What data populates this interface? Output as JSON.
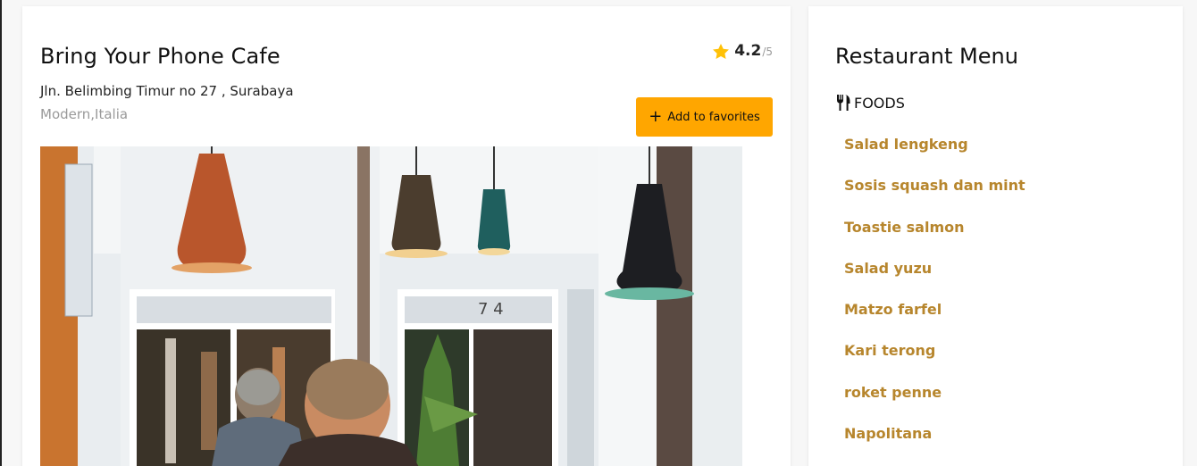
{
  "restaurant": {
    "name": "Bring Your Phone Cafe",
    "address": "Jln. Belimbing Timur no 27 , Surabaya",
    "tags": "Modern,Italia",
    "rating_value": "4.2",
    "rating_max": "/5",
    "favorite_label": "Add to favorites",
    "favorite_icon": "plus-icon",
    "rating_icon": "star-icon",
    "photo_icon": "cafe-photo"
  },
  "menu": {
    "title": "Restaurant Menu",
    "section_label": "FOODS",
    "section_icon": "utensils-icon",
    "items": [
      "Salad lengkeng",
      "Sosis squash dan mint",
      "Toastie salmon",
      "Salad yuzu",
      "Matzo farfel",
      "Kari terong",
      "roket penne",
      "Napolitana"
    ]
  },
  "colors": {
    "accent": "#ffa600",
    "star": "#ffc107",
    "menu_item": "#b7862d",
    "muted": "#9a9a9a"
  }
}
